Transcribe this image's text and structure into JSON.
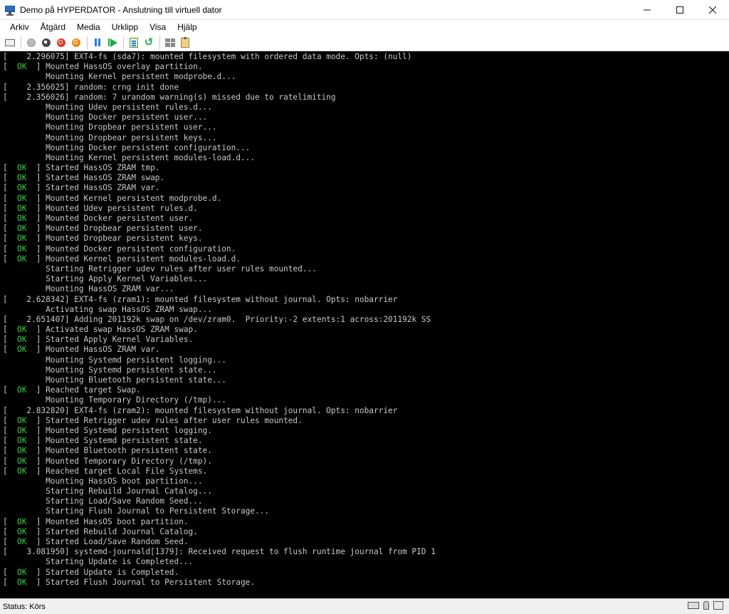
{
  "window": {
    "title": "Demo på HYPERDATOR - Anslutning till virtuell dator",
    "minimize_glyph": "—",
    "maximize_glyph": "☐",
    "close_glyph": "✕"
  },
  "menu": [
    "Arkiv",
    "Åtgärd",
    "Media",
    "Urklipp",
    "Visa",
    "Hjälp"
  ],
  "toolbar": {
    "icons": [
      "ctrl-alt-del-icon",
      "start-icon",
      "turn-off-icon",
      "shut-down-icon",
      "power-icon",
      "pause-icon",
      "resume-icon",
      "checkpoint-icon",
      "revert-icon",
      "enhanced-session-icon",
      "share-icon"
    ]
  },
  "console": {
    "lines": [
      {
        "t": "[    2.296075] EXT4-fs (sda7): mounted filesystem with ordered data mode. Opts: (null)"
      },
      {
        "ok": true,
        "t": "Mounted HassOS overlay partition."
      },
      {
        "t": "         Mounting Kernel persistent modprobe.d..."
      },
      {
        "t": "[    2.356025] random: crng init done"
      },
      {
        "t": "[    2.356026] random: 7 urandom warning(s) missed due to ratelimiting"
      },
      {
        "t": "         Mounting Udev persistent rules.d..."
      },
      {
        "t": "         Mounting Docker persistent user..."
      },
      {
        "t": "         Mounting Dropbear persistent user..."
      },
      {
        "t": "         Mounting Dropbear persistent keys..."
      },
      {
        "t": "         Mounting Docker persistent configuration..."
      },
      {
        "t": "         Mounting Kernel persistent modules-load.d..."
      },
      {
        "ok": true,
        "t": "Started HassOS ZRAM tmp."
      },
      {
        "ok": true,
        "t": "Started HassOS ZRAM swap."
      },
      {
        "ok": true,
        "t": "Started HassOS ZRAM var."
      },
      {
        "ok": true,
        "t": "Mounted Kernel persistent modprobe.d."
      },
      {
        "ok": true,
        "t": "Mounted Udev persistent rules.d."
      },
      {
        "ok": true,
        "t": "Mounted Docker persistent user."
      },
      {
        "ok": true,
        "t": "Mounted Dropbear persistent user."
      },
      {
        "ok": true,
        "t": "Mounted Dropbear persistent keys."
      },
      {
        "ok": true,
        "t": "Mounted Docker persistent configuration."
      },
      {
        "ok": true,
        "t": "Mounted Kernel persistent modules-load.d."
      },
      {
        "t": "         Starting Retrigger udev rules after user rules mounted..."
      },
      {
        "t": "         Starting Apply Kernel Variables..."
      },
      {
        "t": "         Mounting HassOS ZRAM var..."
      },
      {
        "t": "[    2.628342] EXT4-fs (zram1): mounted filesystem without journal. Opts: nobarrier"
      },
      {
        "t": "         Activating swap HassOS ZRAM swap..."
      },
      {
        "t": "[    2.651407] Adding 201192k swap on /dev/zram0.  Priority:-2 extents:1 across:201192k SS"
      },
      {
        "ok": true,
        "t": "Activated swap HassOS ZRAM swap."
      },
      {
        "ok": true,
        "t": "Started Apply Kernel Variables."
      },
      {
        "ok": true,
        "t": "Mounted HassOS ZRAM var."
      },
      {
        "t": "         Mounting Systemd persistent logging..."
      },
      {
        "t": "         Mounting Systemd persistent state..."
      },
      {
        "t": "         Mounting Bluetooth persistent state..."
      },
      {
        "ok": true,
        "t": "Reached target Swap."
      },
      {
        "t": "         Mounting Temporary Directory (/tmp)..."
      },
      {
        "t": "[    2.832820] EXT4-fs (zram2): mounted filesystem without journal. Opts: nobarrier"
      },
      {
        "ok": true,
        "t": "Started Retrigger udev rules after user rules mounted."
      },
      {
        "ok": true,
        "t": "Mounted Systemd persistent logging."
      },
      {
        "ok": true,
        "t": "Mounted Systemd persistent state."
      },
      {
        "ok": true,
        "t": "Mounted Bluetooth persistent state."
      },
      {
        "ok": true,
        "t": "Mounted Temporary Directory (/tmp)."
      },
      {
        "ok": true,
        "t": "Reached target Local File Systems."
      },
      {
        "t": "         Mounting HassOS boot partition..."
      },
      {
        "t": "         Starting Rebuild Journal Catalog..."
      },
      {
        "t": "         Starting Load/Save Random Seed..."
      },
      {
        "t": "         Starting Flush Journal to Persistent Storage..."
      },
      {
        "ok": true,
        "t": "Mounted HassOS boot partition."
      },
      {
        "ok": true,
        "t": "Started Rebuild Journal Catalog."
      },
      {
        "ok": true,
        "t": "Started Load/Save Random Seed."
      },
      {
        "t": "[    3.081950] systemd-journald[1379]: Received request to flush runtime journal from PID 1"
      },
      {
        "t": "         Starting Update is Completed..."
      },
      {
        "ok": true,
        "t": "Started Update is Completed."
      },
      {
        "ok": true,
        "t": "Started Flush Journal to Persistent Storage."
      }
    ]
  },
  "status": {
    "text": "Status: Körs"
  }
}
